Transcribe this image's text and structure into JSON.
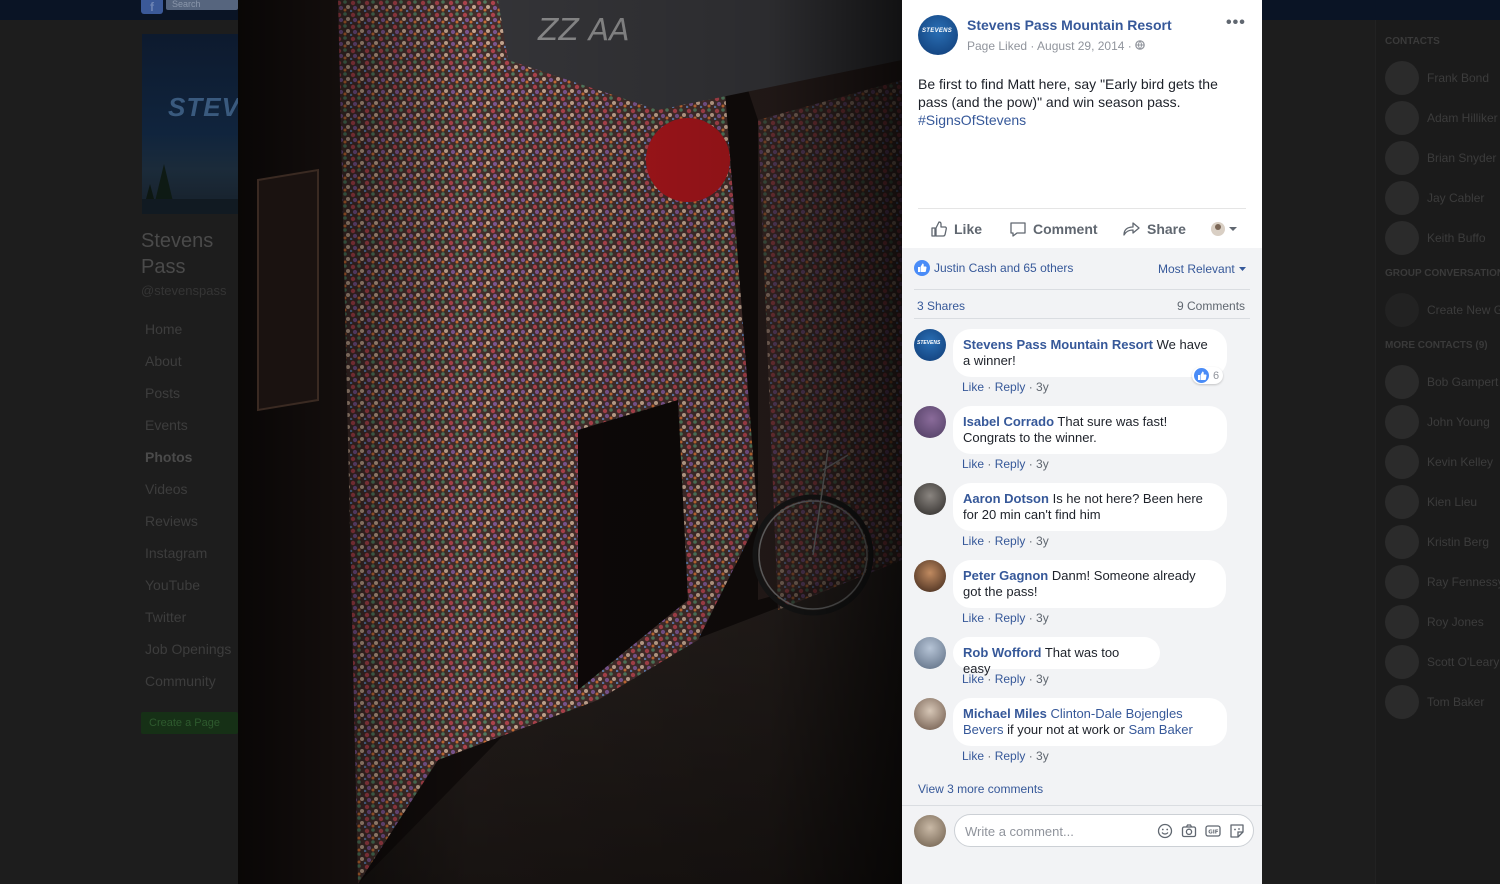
{
  "background_page": {
    "search_placeholder": "Search",
    "cover_text": "STEV",
    "page_name": "Stevens Pass\nMountain Resort",
    "page_handle": "@stevenspass",
    "nav_items": [
      {
        "label": "Home",
        "active": false
      },
      {
        "label": "About",
        "active": false
      },
      {
        "label": "Posts",
        "active": false
      },
      {
        "label": "Events",
        "active": false
      },
      {
        "label": "Photos",
        "active": true
      },
      {
        "label": "Videos",
        "active": false
      },
      {
        "label": "Reviews",
        "active": false
      },
      {
        "label": "Instagram",
        "active": false
      },
      {
        "label": "YouTube",
        "active": false
      },
      {
        "label": "Twitter",
        "active": false
      },
      {
        "label": "Job Openings",
        "active": false
      },
      {
        "label": "Community",
        "active": false
      }
    ],
    "create_page_label": "Create a Page"
  },
  "chat_sidebar": {
    "contacts_heading": "CONTACTS",
    "contacts": [
      "Frank Bond",
      "Adam Hilliker",
      "Brian Snyder",
      "Jay Cabler",
      "Keith Buffo"
    ],
    "group_heading": "GROUP CONVERSATIONS",
    "create_new_group": "Create New Group",
    "more_contacts_heading": "MORE CONTACTS (9)",
    "more_contacts": [
      "Bob Gampert",
      "John Young",
      "Kevin Kelley",
      "Kien Lieu",
      "Kristin Berg",
      "Ray Fennessy",
      "Roy Jones",
      "Scott O'Leary",
      "Tom Baker"
    ]
  },
  "post": {
    "page_avatar_text": "STEVENS",
    "title": "Stevens Pass Mountain Resort",
    "meta": "Page Liked · August 29, 2014 · ",
    "text": "Be first to find Matt here, say \"Early bird gets the pass (and the pow)\" and win season pass.",
    "hashtag": "#SignsOfStevens",
    "more_label": "•••",
    "actions": {
      "like": "Like",
      "comment": "Comment",
      "share": "Share"
    },
    "reactions_text": "Justin Cash and 65 others",
    "sort_label": "Most Relevant",
    "shares_text": "3 Shares",
    "comments_text": "9 Comments"
  },
  "comments": [
    {
      "author": "Stevens Pass Mountain Resort",
      "text": "We have a winner!",
      "line1": "We have",
      "line2": "a winner!",
      "likes": "6",
      "like": "Like",
      "reply": "Reply",
      "time": "3y"
    },
    {
      "author": "Isabel Corrado",
      "line1": "That sure was fast!",
      "line2": "Congrats to the winner.",
      "like": "Like",
      "reply": "Reply",
      "time": "3y"
    },
    {
      "author": "Aaron Dotson",
      "line1": "Is he not here? Been here",
      "line2": "for 20 min can't find him",
      "like": "Like",
      "reply": "Reply",
      "time": "3y"
    },
    {
      "author": "Peter Gagnon",
      "line1": "Danm! Someone already",
      "line2": "got the pass!",
      "like": "Like",
      "reply": "Reply",
      "time": "3y"
    },
    {
      "author": "Rob Wofford",
      "line1": "That was too easy",
      "like": "Like",
      "reply": "Reply",
      "time": "3y"
    },
    {
      "author": "Michael Miles",
      "mention1": "Clinton-Dale Bojengles",
      "mention1_b": "Bevers",
      "middle": " if your not at work or ",
      "mention2": "Sam Baker",
      "like": "Like",
      "reply": "Reply",
      "time": "3y"
    }
  ],
  "view_more": "View 3 more comments",
  "composer": {
    "placeholder": "Write a comment..."
  },
  "colors": {
    "link_blue": "#365899",
    "like_blue": "#4a8cf7",
    "panel_bg": "#f2f3f5"
  }
}
